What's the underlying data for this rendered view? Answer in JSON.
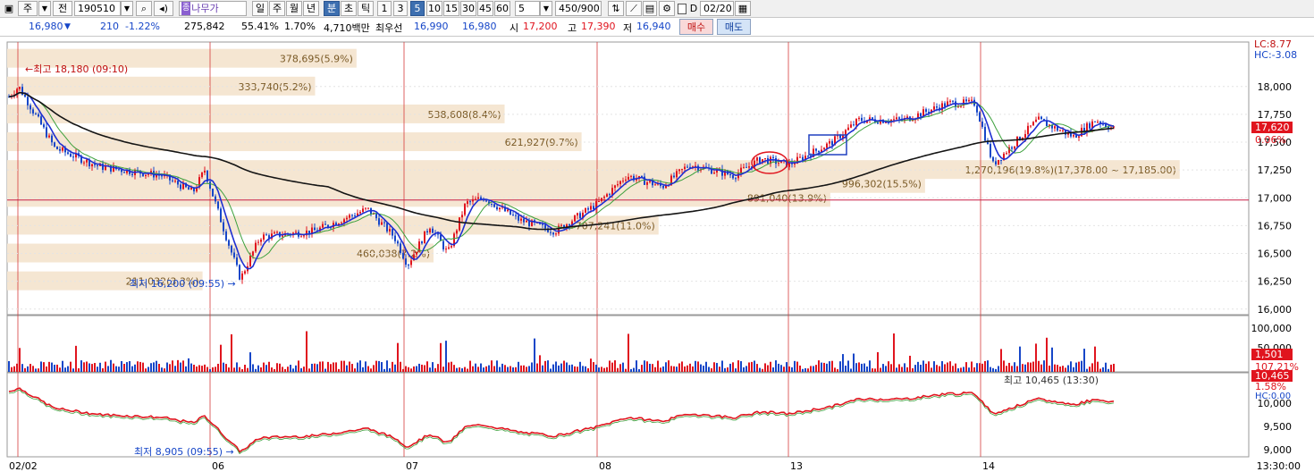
{
  "toolbar": {
    "mode": "주",
    "prev": "전",
    "code": "190510",
    "stock_badge": "종",
    "stock_name": "나무가",
    "periods": [
      "일",
      "주",
      "월",
      "년",
      "분",
      "초",
      "틱"
    ],
    "active_period": "분",
    "intervals": [
      "1",
      "3",
      "5",
      "10",
      "15",
      "30",
      "45",
      "60"
    ],
    "active_interval": "5",
    "interval_select": "5",
    "count": "450/900",
    "check_label": "D",
    "date": "02/20"
  },
  "quote": {
    "price": "16,980",
    "change": "210",
    "rate": "-1.22%",
    "volume": "275,842",
    "vol_rate": "55.41%",
    "turnover": "1.70%",
    "amount": "4,710백만",
    "best_label": "최우선",
    "best_ask": "16,990",
    "best_bid": "16,980",
    "open_label": "시",
    "open": "17,200",
    "high_label": "고",
    "high": "17,390",
    "low_label": "저",
    "low": "16,940",
    "buy": "매수",
    "sell": "매도"
  },
  "colors": {
    "up": "#e0141e",
    "down": "#1646c8",
    "ma5": "#1e2fd2",
    "ma20": "#3ca03c",
    "ma120": "#141414",
    "profile": "#f5e6d2",
    "label": "#7a5a26"
  },
  "chart_data": {
    "type": "candlestick",
    "x_labels": [
      "02/02",
      "06",
      "07",
      "08",
      "13",
      "14"
    ],
    "time_label": "13:30:00",
    "price_axis": {
      "ticks": [
        "18,000",
        "17,750",
        "17,500",
        "17,250",
        "17,000",
        "16,750",
        "16,500",
        "16,250",
        "16,000"
      ],
      "ylim": [
        15950,
        18400
      ],
      "lc": "LC:8.77",
      "hc": "HC:-3.08",
      "current": "17,620",
      "current_rate": "0.06%",
      "ref_line": 16980
    },
    "high_note": "최고 18,180 (09:10)",
    "low_note": "최저 16,200 (09:55)",
    "volume_profile": [
      {
        "price": 16250,
        "label": "211,032(3.3%)"
      },
      {
        "price": 16500,
        "label": "460,038(7.2%)"
      },
      {
        "price": 16750,
        "label": "707,241(11.0%)"
      },
      {
        "price": 17000,
        "label": "891,040(13.9%)"
      },
      {
        "price": 17250,
        "label": "1,270,196(19.8%)(17,378.00 ~ 17,185.00)"
      },
      {
        "price": 17500,
        "label": "621,927(9.7%)"
      },
      {
        "price": 17750,
        "label": "538,608(8.4%)"
      },
      {
        "price": 18000,
        "label": "333,740(5.2%)"
      },
      {
        "price": 18250,
        "label": "378,695(5.9%)"
      },
      {
        "price": 17125,
        "label": "996,302(15.5%)"
      }
    ],
    "volume_axis": {
      "ticks": [
        "100,000",
        "50,000"
      ],
      "current": "1,501",
      "rate": "107.21%"
    },
    "index_panel": {
      "ticks": [
        "10,000",
        "9,500",
        "9,000"
      ],
      "current": "10,465",
      "rate": "1.58%",
      "hc": "HC:0.00",
      "high_note": "최고 10,465 (13:30)",
      "low_note": "최저 8,905 (09:55)"
    }
  }
}
